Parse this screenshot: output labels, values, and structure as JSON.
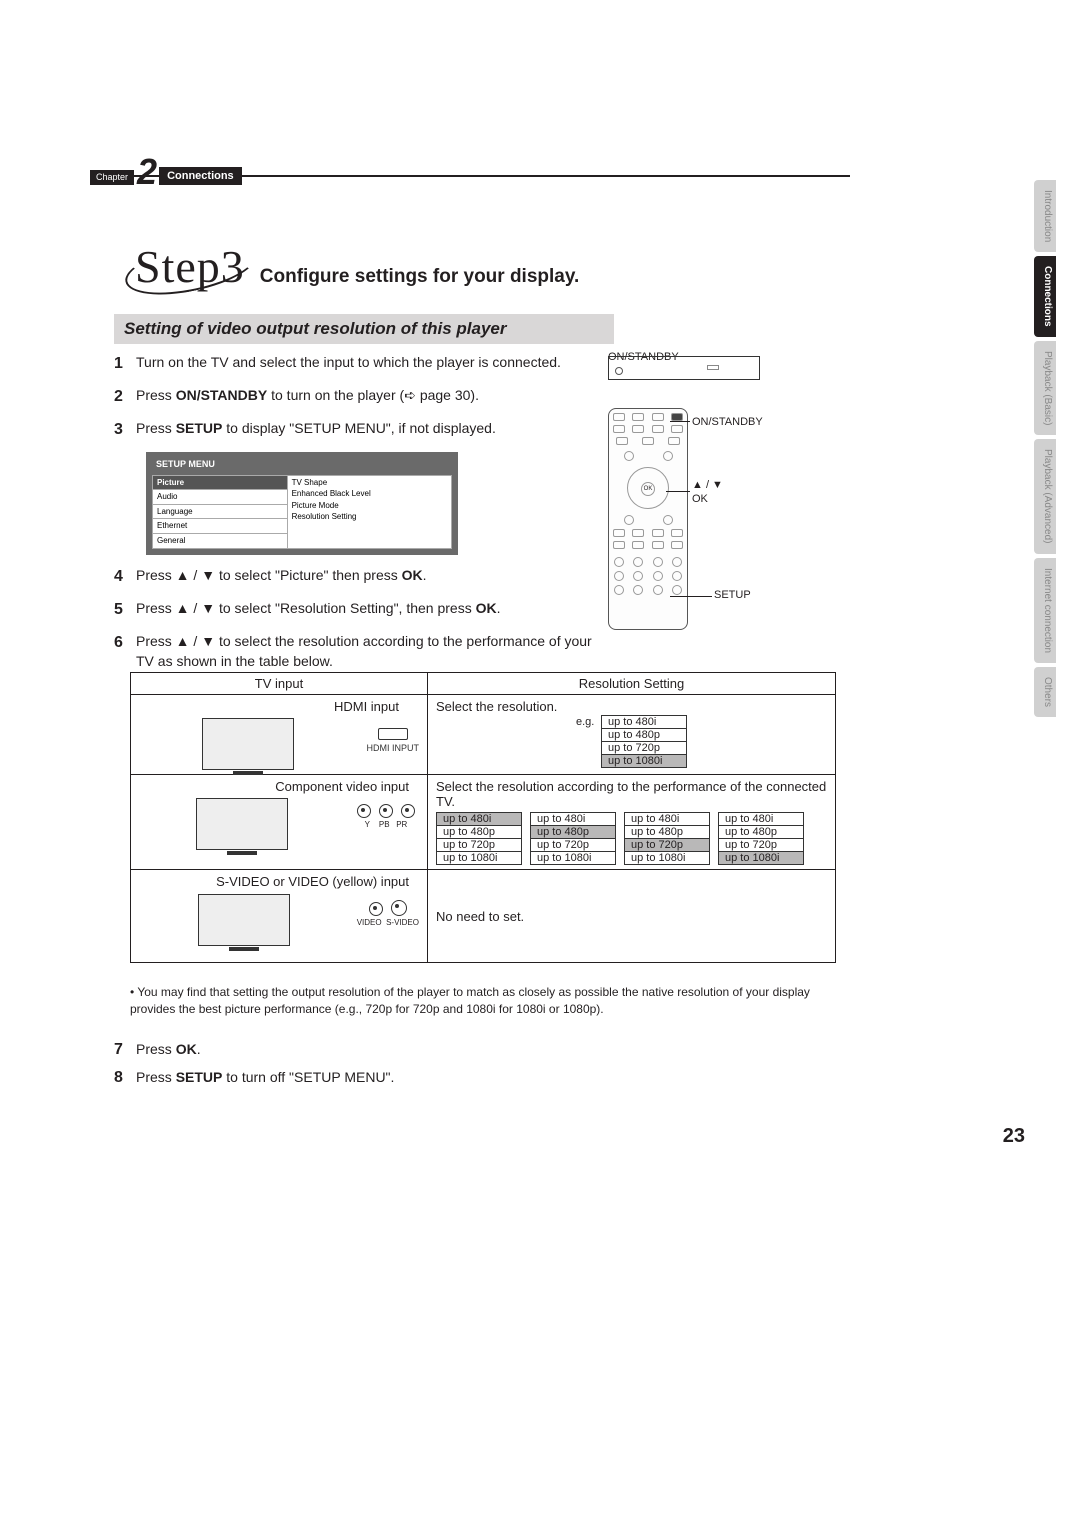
{
  "chapter": {
    "label": "Chapter",
    "number": "2",
    "title": "Connections"
  },
  "step": {
    "big": "Step3",
    "title": "Configure settings for your display."
  },
  "section_heading": "Setting of video output resolution of this player",
  "steps": {
    "s1": {
      "num": "1",
      "text": "Turn on the TV and select the input to which the player is connected."
    },
    "s2": {
      "num": "2",
      "text_a": "Press ",
      "bold": "ON/STANDBY",
      "text_b": " to turn on the player (",
      "ref": "page 30",
      "text_c": ")."
    },
    "s3": {
      "num": "3",
      "text_a": "Press ",
      "bold": "SETUP",
      "text_b": " to display \"SETUP MENU\", if not displayed."
    },
    "s4": {
      "num": "4",
      "text_a": "Press ▲ / ▼ to select \"Picture\" then press ",
      "bold": "OK",
      "text_b": "."
    },
    "s5": {
      "num": "5",
      "text_a": "Press ▲ / ▼ to select \"Resolution Setting\", then press ",
      "bold": "OK",
      "text_b": "."
    },
    "s6": {
      "num": "6",
      "text": "Press ▲ / ▼ to select the resolution according to the performance of your TV as shown in the table below."
    },
    "s7": {
      "num": "7",
      "text_a": "Press ",
      "bold": "OK",
      "text_b": "."
    },
    "s8": {
      "num": "8",
      "text_a": "Press ",
      "bold": "SETUP",
      "text_b": " to turn off \"SETUP MENU\"."
    }
  },
  "setup_menu": {
    "title": "SETUP MENU",
    "left": [
      "Picture",
      "Audio",
      "Language",
      "Ethernet",
      "General"
    ],
    "right": [
      "TV Shape",
      "Enhanced Black Level",
      "Picture Mode",
      "Resolution Setting"
    ]
  },
  "remote": {
    "on_standby": "ON/STANDBY",
    "arrows": "▲ / ▼",
    "ok": "OK",
    "setup": "SETUP"
  },
  "table": {
    "header_left": "TV input",
    "header_right": "Resolution Setting",
    "row1": {
      "label": "HDMI input",
      "sub": "HDMI INPUT",
      "text": "Select the resolution.",
      "eg": "e.g.",
      "opts": [
        "up to 480i",
        "up to 480p",
        "up to 720p",
        "up to 1080i"
      ],
      "hl_index": 3
    },
    "row2": {
      "label": "Component video input",
      "sub_y": "Y",
      "sub_pb": "PB",
      "sub_pr": "PR",
      "text": "Select the resolution according to the performance of the connected TV.",
      "cols": [
        {
          "opts": [
            "up to 480i",
            "up to 480p",
            "up to 720p",
            "up to 1080i"
          ],
          "hl": 0
        },
        {
          "opts": [
            "up to 480i",
            "up to 480p",
            "up to 720p",
            "up to 1080i"
          ],
          "hl": 1
        },
        {
          "opts": [
            "up to 480i",
            "up to 480p",
            "up to 720p",
            "up to 1080i"
          ],
          "hl": 2
        },
        {
          "opts": [
            "up to 480i",
            "up to 480p",
            "up to 720p",
            "up to 1080i"
          ],
          "hl": 3
        }
      ]
    },
    "row3": {
      "label": "S-VIDEO or VIDEO (yellow) input",
      "sub_v": "VIDEO",
      "sub_s": "S-VIDEO",
      "text": "No need to set."
    }
  },
  "note": "• You may find that setting the output resolution of the player to match as closely as possible the native resolution of your display provides the best picture performance (e.g., 720p for 720p and 1080i for 1080i or 1080p).",
  "side_tabs": [
    "Introduction",
    "Connections",
    "Playback (Basic)",
    "Playback (Advanced)",
    "Internet connection",
    "Others"
  ],
  "page_number": "23"
}
